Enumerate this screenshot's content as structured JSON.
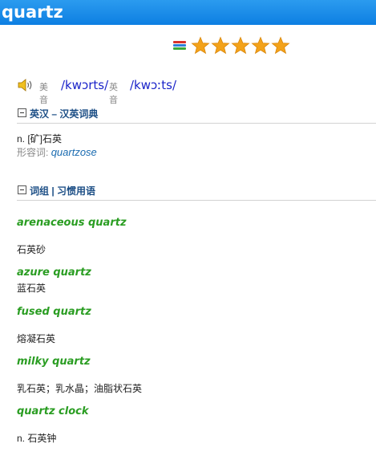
{
  "header": {
    "word": "quartz"
  },
  "rating": {
    "stars": 5,
    "max": 5,
    "icons": [
      "frequency-bars-icon",
      "star-icon"
    ],
    "colors": {
      "bar_top": "#d8322b",
      "bar_mid": "#2e7fd8",
      "bar_bottom": "#3aa93a",
      "star": "#f3a21a"
    }
  },
  "pronunciation": {
    "us_label": "美音",
    "us_ipa": "/kwɔrts/",
    "uk_label": "英音",
    "uk_ipa": "/kwɔːts/",
    "icon": "speaker-icon"
  },
  "sections": {
    "dict": {
      "title": "英汉 – 汉英词典"
    },
    "phrases": {
      "title": "词组 | 习惯用语"
    }
  },
  "definition": {
    "line": "n. [矿]石英",
    "adj_label": "形容词:",
    "adj_word": "quartzose"
  },
  "phrases": [
    {
      "term": "arenaceous quartz",
      "meaning": "石英砂"
    },
    {
      "term": "azure quartz",
      "meaning": "蓝石英"
    },
    {
      "term": "fused quartz",
      "meaning": "熔凝石英"
    },
    {
      "term": "milky quartz",
      "meaning": "乳石英；乳水晶；油脂状石英"
    },
    {
      "term": "quartz clock",
      "meaning": "n. 石英钟"
    }
  ],
  "colors": {
    "title_bar": "#1a8ae8",
    "phrase": "#2a9d22",
    "ipa": "#1a23c9",
    "section_title": "#1d4f86"
  }
}
